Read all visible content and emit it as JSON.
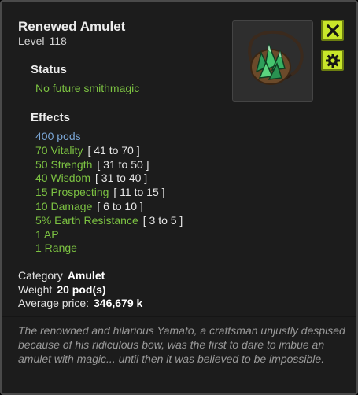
{
  "item": {
    "name": "Renewed Amulet",
    "level_label": "Level",
    "level": "118"
  },
  "status": {
    "heading": "Status",
    "text": "No future smithmagic"
  },
  "effects": {
    "heading": "Effects",
    "list": [
      {
        "text": "400 pods",
        "range": "",
        "color": "blue"
      },
      {
        "text": "70 Vitality",
        "range": "[ 41 to 70 ]",
        "color": "green"
      },
      {
        "text": "50 Strength",
        "range": "[ 31 to 50 ]",
        "color": "green"
      },
      {
        "text": "40 Wisdom",
        "range": "[ 31 to 40 ]",
        "color": "green"
      },
      {
        "text": "15 Prospecting",
        "range": "[ 11 to 15 ]",
        "color": "green"
      },
      {
        "text": "10 Damage",
        "range": "[ 6 to 10 ]",
        "color": "green"
      },
      {
        "text": "5% Earth Resistance",
        "range": "[ 3 to 5 ]",
        "color": "green"
      },
      {
        "text": "1 AP",
        "range": "",
        "color": "green"
      },
      {
        "text": "1 Range",
        "range": "",
        "color": "green"
      }
    ]
  },
  "info": {
    "category_label": "Category",
    "category_value": "Amulet",
    "weight_label": "Weight",
    "weight_value": "20 pod(s)",
    "price_label": "Average price:",
    "price_value": "346,679 k"
  },
  "description": "The renowned and hilarious Yamato, a craftsman unjustly despised because of his ridiculous bow, was the first to dare to imbue an amulet with magic... until then it was believed to be impossible.",
  "icons": {
    "close": "close-icon",
    "settings": "gear-icon",
    "item": "amulet-icon"
  },
  "colors": {
    "bonus_green": "#7cc242",
    "pods_blue": "#7aa6d6",
    "button_lime": "#c8e62a"
  }
}
